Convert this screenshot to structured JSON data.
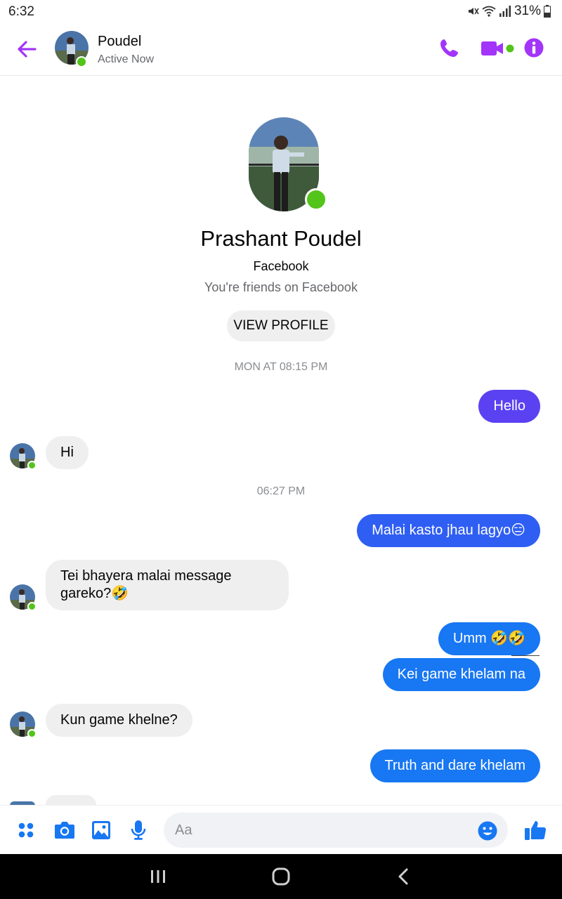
{
  "status_bar": {
    "time": "6:32",
    "battery": "31%",
    "icons": [
      "mute-icon",
      "wifi-icon",
      "signal-icon",
      "battery-icon"
    ]
  },
  "header": {
    "contact_name": "Poudel",
    "status": "Active Now",
    "icons": [
      "back-arrow-icon",
      "phone-icon",
      "video-camera-icon",
      "info-icon"
    ]
  },
  "profile": {
    "full_name": "Prashant Poudel",
    "platform": "Facebook",
    "relation": "You're friends on Facebook",
    "button_label": "VIEW PROFILE"
  },
  "conversation": {
    "timestamps": [
      "MON AT 08:15 PM",
      "06:27 PM"
    ],
    "messages": [
      {
        "from": "me",
        "text": "Hello"
      },
      {
        "from": "them",
        "text": "Hi"
      },
      {
        "from": "me",
        "text": "Malai kasto jhau lagyo😑"
      },
      {
        "from": "them",
        "text": "Tei bhayera malai message gareko?🤣"
      },
      {
        "from": "me",
        "text": "Umm 🤣🤣"
      },
      {
        "from": "me",
        "text": "Kei game khelam na"
      },
      {
        "from": "them",
        "text": "Kun game khelne?"
      },
      {
        "from": "me",
        "text": "Truth and dare khelam"
      }
    ]
  },
  "composer": {
    "placeholder": "Aa",
    "icons": [
      "apps-grid-icon",
      "camera-icon",
      "gallery-icon",
      "microphone-icon",
      "emoji-icon",
      "thumbs-up-icon"
    ]
  },
  "navigation": {
    "icons": [
      "recent-apps-icon",
      "home-icon",
      "back-icon"
    ]
  },
  "colors": {
    "accent_purple": "#a334fa",
    "bubble_blue": "#1877f2",
    "bubble_indigo": "#5a42f2",
    "bubble_gray": "#efefef",
    "online_green": "#52c41a"
  }
}
